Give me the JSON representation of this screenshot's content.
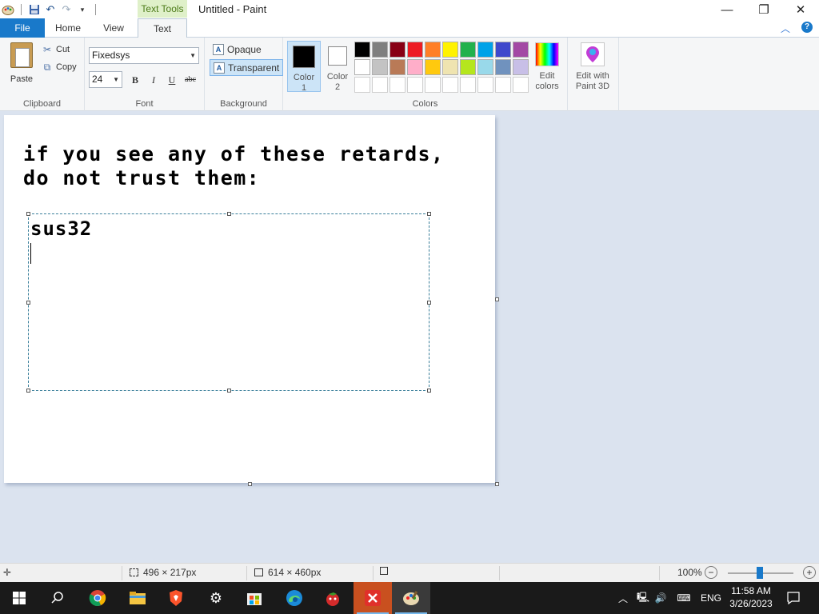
{
  "window": {
    "title": "Untitled - Paint",
    "context_tab": "Text Tools",
    "controls": [
      "minimize",
      "restore",
      "close"
    ]
  },
  "tabs": {
    "file": "File",
    "home": "Home",
    "view": "View",
    "text": "Text",
    "active": "Text"
  },
  "clipboard": {
    "paste_label": "Paste",
    "cut_label": "Cut",
    "copy_label": "Copy",
    "group_label": "Clipboard"
  },
  "font": {
    "family": "Fixedsys",
    "size": "24",
    "bold": "B",
    "italic": "I",
    "underline": "U",
    "strike": "abc",
    "group_label": "Font"
  },
  "background": {
    "opaque_label": "Opaque",
    "transparent_label": "Transparent",
    "selected": "Transparent",
    "group_label": "Background"
  },
  "colors": {
    "color1_label": "Color 1",
    "color1_line1": "Color",
    "color1_line2": "1",
    "color1_value": "#000000",
    "color2_line1": "Color",
    "color2_line2": "2",
    "color2_value": "#ffffff",
    "palette": [
      "#000000",
      "#7f7f7f",
      "#880015",
      "#ed1c24",
      "#ff7f27",
      "#fff200",
      "#22b14c",
      "#00a2e8",
      "#3f48cc",
      "#a349a4",
      "#ffffff",
      "#c3c3c3",
      "#b97a57",
      "#ffaec9",
      "#ffc90e",
      "#efe4b0",
      "#b5e61d",
      "#99d9ea",
      "#7092be",
      "#c8bfe7",
      "#ffffff",
      "#ffffff",
      "#ffffff",
      "#ffffff",
      "#ffffff",
      "#ffffff",
      "#ffffff",
      "#ffffff",
      "#ffffff",
      "#ffffff"
    ],
    "edit_colors_line1": "Edit",
    "edit_colors_line2": "colors",
    "group_label": "Colors"
  },
  "paint3d": {
    "line1": "Edit with",
    "line2": "Paint 3D"
  },
  "canvas": {
    "text_line1": "if you see any of these retards,",
    "text_line2": "do not trust them:",
    "textbox_text": "sus32"
  },
  "status": {
    "selection_size": "496 × 217px",
    "canvas_size": "614 × 460px",
    "zoom": "100%",
    "zoom_level_percent": 100
  },
  "taskbar": {
    "apps": [
      "start-icon",
      "search-icon",
      "chrome-icon",
      "file-explorer-icon",
      "brave-icon",
      "settings-icon",
      "store-icon",
      "edge-icon",
      "tomato-app-icon",
      "red-x-app-icon",
      "paint-icon"
    ],
    "language": "ENG",
    "time": "11:58 AM",
    "date": "3/26/2023"
  }
}
